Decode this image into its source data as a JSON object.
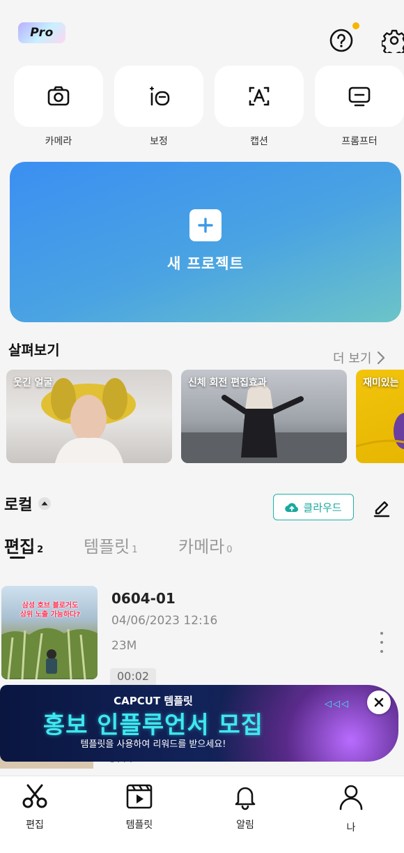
{
  "header": {
    "pro_badge": "Pro",
    "icons": {
      "help": "help-circle-icon",
      "settings": "gear-icon"
    },
    "notification_dot_color": "#f7b500"
  },
  "quick_actions": [
    {
      "label": "카메라",
      "icon": "camera-icon"
    },
    {
      "label": "보정",
      "icon": "retouch-icon"
    },
    {
      "label": "캡션",
      "icon": "caption-icon"
    },
    {
      "label": "프롬프터",
      "icon": "prompter-icon"
    }
  ],
  "new_project": {
    "label": "새 프로젝트",
    "icon": "plus-icon"
  },
  "browse": {
    "title": "살펴보기",
    "more": "더 보기",
    "cards": [
      {
        "label": "웃긴 얼굴"
      },
      {
        "label": "신체 회전 편집효과"
      },
      {
        "label": "재미있는"
      }
    ]
  },
  "local": {
    "title": "로컬",
    "cloud_button": "클라우드",
    "tabs": [
      {
        "label": "편집",
        "count": "2"
      },
      {
        "label": "템플릿",
        "count": "1"
      },
      {
        "label": "카메라",
        "count": "0"
      }
    ],
    "projects": [
      {
        "name": "0604-01",
        "date": "04/06/2023 12:16",
        "size": "23M",
        "duration": "00:02",
        "thumb_caption": "삼성 호브 블로거도\n상위 노출 가능하다?"
      }
    ],
    "next_project_size": "87M"
  },
  "banner": {
    "top": "CAPCUT 템플릿",
    "main": "홍보 인플루언서 모집",
    "sub": "템플릿을 사용하여 리워드를 받으세요!",
    "arrows": "◁◁◁"
  },
  "bottom_nav": [
    {
      "label": "편집",
      "icon": "scissors-icon"
    },
    {
      "label": "템플릿",
      "icon": "template-icon"
    },
    {
      "label": "알림",
      "icon": "bell-icon"
    },
    {
      "label": "나",
      "icon": "person-icon"
    }
  ]
}
